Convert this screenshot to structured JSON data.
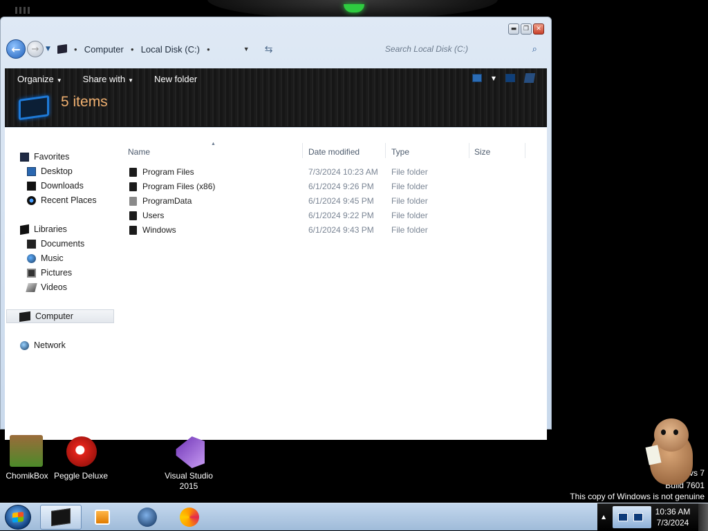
{
  "window": {
    "address": {
      "segments": [
        "Computer",
        "Local Disk (C:)"
      ]
    },
    "search": {
      "placeholder": "Search Local Disk (C:)"
    },
    "toolbar": {
      "organize_label": "Organize",
      "share_label": "Share with",
      "new_folder_label": "New folder"
    },
    "header": {
      "item_count": "5 items"
    },
    "nav_pane": {
      "favorites": "Favorites",
      "desktop": "Desktop",
      "downloads": "Downloads",
      "recent": "Recent Places",
      "libraries": "Libraries",
      "documents": "Documents",
      "music": "Music",
      "pictures": "Pictures",
      "videos": "Videos",
      "computer": "Computer",
      "network": "Network"
    },
    "columns": {
      "name": "Name",
      "date": "Date modified",
      "type": "Type",
      "size": "Size"
    },
    "files": [
      {
        "name": "Program Files",
        "date": "7/3/2024 10:23 AM",
        "type": "File folder"
      },
      {
        "name": "Program Files (x86)",
        "date": "6/1/2024 9:26 PM",
        "type": "File folder"
      },
      {
        "name": "ProgramData",
        "date": "6/1/2024 9:45 PM",
        "type": "File folder"
      },
      {
        "name": "Users",
        "date": "6/1/2024 9:22 PM",
        "type": "File folder"
      },
      {
        "name": "Windows",
        "date": "6/1/2024 9:43 PM",
        "type": "File folder"
      }
    ]
  },
  "desktop_icons": {
    "chomik": "ChomikBox",
    "peggle": "Peggle Deluxe",
    "vs_line1": "Visual Studio",
    "vs_line2": "2015"
  },
  "watermark": {
    "line1": "vs 7",
    "line2": "Build 7601",
    "line3": "This copy of Windows is not genuine"
  },
  "clock": {
    "time": "10:36 AM",
    "date": "7/3/2024"
  },
  "colors": {
    "header_count": "#f0b070",
    "command_bar": "#1b1b1b",
    "taskbar": "#9fbbd9"
  }
}
